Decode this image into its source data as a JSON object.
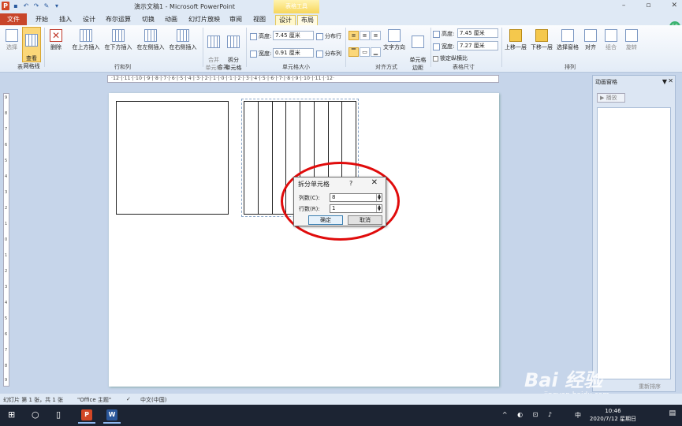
{
  "titlebar": {
    "qat_icons": [
      "powerpoint-app-icon",
      "save-icon",
      "undo-icon",
      "redo-icon",
      "format-painter-icon",
      "customize-qat-icon"
    ],
    "app_letter": "P",
    "title": "演示文稿1 - Microsoft PowerPoint",
    "context_tools": "表格工具",
    "win_buttons": [
      "–",
      "▫",
      "✕"
    ]
  },
  "tabs": {
    "file": "文件",
    "items": [
      "开始",
      "插入",
      "设计",
      "布尔运算",
      "切换",
      "动画",
      "幻灯片放映",
      "审阅",
      "视图"
    ],
    "ctx_design": "设计",
    "ctx_layout": "布局"
  },
  "ribbon": {
    "table_group": {
      "select": "选择",
      "gridlines": "查看\n网格线",
      "label": "表"
    },
    "rowcol_group": {
      "delete": "删除",
      "insert_above": "在上方插入",
      "insert_below": "在下方插入",
      "insert_left": "在左侧插入",
      "insert_right": "在右侧插入",
      "label": "行和列"
    },
    "merge_group": {
      "merge": "合并\n单元格",
      "split": "拆分\n单元格",
      "label": "合并"
    },
    "cellsize_group": {
      "height_label": "高度:",
      "height_value": "7.45 厘米",
      "width_label": "宽度:",
      "width_value": "0.91 厘米",
      "distribute_rows": "分布行",
      "distribute_cols": "分布列",
      "label": "单元格大小"
    },
    "align_group": {
      "text_direction": "文字方向",
      "cell_margins": "单元格\n边距",
      "label": "对齐方式"
    },
    "tablesize_group": {
      "height_label": "高度:",
      "height_value": "7.45 厘米",
      "width_label": "宽度:",
      "width_value": "7.27 厘米",
      "lock_ratio": "锁定纵横比",
      "label": "表格尺寸"
    },
    "arrange_group": {
      "bring_forward": "上移一层",
      "send_backward": "下移一层",
      "selection_pane": "选择窗格",
      "align": "对齐",
      "group": "组合",
      "rotate": "旋转",
      "label": "排列"
    }
  },
  "ruler": {
    "top": "·12·|·11·|·10·|·9·|·8·|·7·|·6·|·5·|·4·|·3·|·2·|·1·|·0·|·1·|·2·|·3·|·4·|·5·|·6·|·7·|·8·|·9·|·10·|·11·|·12·",
    "left": [
      "9",
      "8",
      "7",
      "6",
      "5",
      "4",
      "3",
      "2",
      "1",
      "0",
      "1",
      "2",
      "3",
      "4",
      "5",
      "6",
      "7",
      "8",
      "9"
    ]
  },
  "slide": {
    "table": {
      "columns": 8
    }
  },
  "dialog": {
    "title": "拆分单元格",
    "help": "?",
    "close": "✕",
    "cols_label": "列数(C):",
    "cols_value": "8",
    "rows_label": "行数(R):",
    "rows_value": "1",
    "ok": "确定",
    "cancel": "取消"
  },
  "animation_pane": {
    "title": "动画窗格",
    "play": "▶ 播放",
    "reorder": "重新排序"
  },
  "statusbar": {
    "slide_info": "幻灯片 第 1 张，共 1 张",
    "theme": "\"Office 主题\"",
    "language": "中文(中国)"
  },
  "taskbar": {
    "tray": "^ ◐ ⊡ ♪",
    "ime": "中",
    "time": "10:46",
    "date": "2020/7/12 星期日",
    "apps": [
      "P",
      "W"
    ]
  },
  "watermark": {
    "logo": "Bai 经验",
    "url": "jingyan.baidu.com"
  },
  "colors": {
    "file_tab": "#c8452a",
    "highlight_ellipse": "#e00b0b",
    "ribbon_selected": "#fbd779",
    "context_tab": "#f7d65a"
  }
}
